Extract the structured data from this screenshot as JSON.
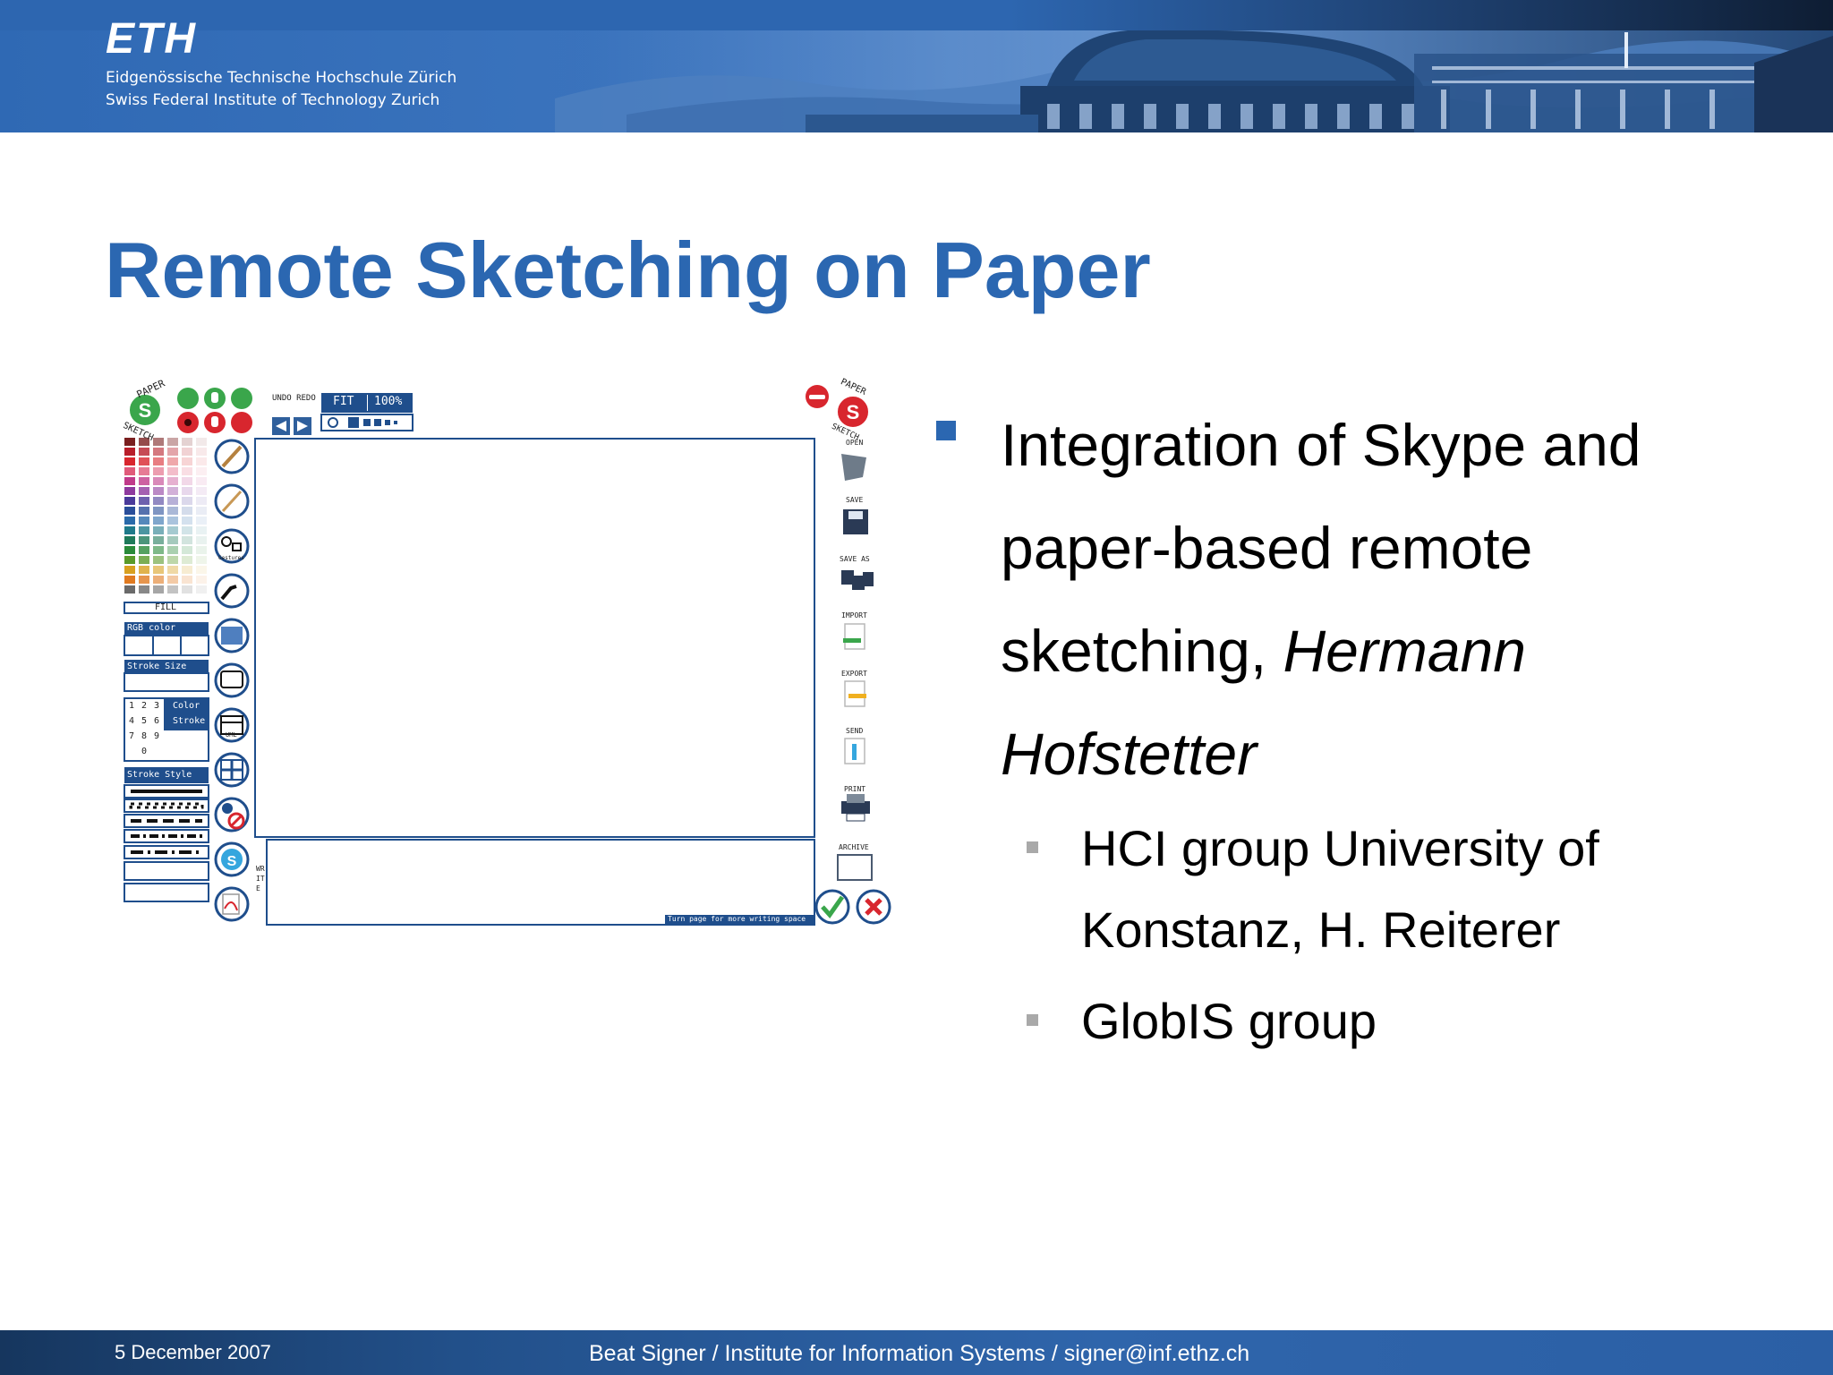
{
  "header": {
    "logo": "ETH",
    "institution_de": "Eidgenössische Technische Hochschule Zürich",
    "institution_en": "Swiss Federal Institute of Technology Zurich"
  },
  "title": "Remote Sketching on Paper",
  "bullets": {
    "main": {
      "text": "Integration of Skype and paper-based remote sketching, ",
      "author": "Hermann Hofstetter"
    },
    "sub": [
      "HCI group University of Konstanz, H. Reiterer",
      "GlobIS group"
    ]
  },
  "footer": {
    "date": "5 December 2007",
    "author": "Beat Signer / Institute for Information Systems / signer@inf.ethz.ch"
  },
  "app_screenshot": {
    "brand_top": "PAPER",
    "brand_bottom": "SKETCH",
    "undo_redo": "UNDO REDO",
    "fit": "FIT",
    "zoom": "100%",
    "fill": "FILL",
    "rgb_color": "RGB color",
    "stroke_size": "Stroke Size",
    "keypad": [
      "1",
      "2",
      "3",
      "4",
      "5",
      "6",
      "7",
      "8",
      "9",
      "0"
    ],
    "keypad_color": "Color",
    "keypad_stroke": "Stroke",
    "stroke_style": "Stroke Style",
    "gestures": "Gestures",
    "uml": "UML",
    "write": "WRITE",
    "turn_page": "Turn page for more writing space",
    "right_tools": [
      "OPEN",
      "SAVE",
      "SAVE AS",
      "IMPORT",
      "EXPORT",
      "SEND",
      "PRINT",
      "ARCHIVE"
    ],
    "colors": {
      "brand_blue": "#2b67b1",
      "frame_blue": "#1f4e8c",
      "skype_green": "#3aa64b",
      "alert_red": "#d8262e"
    }
  }
}
